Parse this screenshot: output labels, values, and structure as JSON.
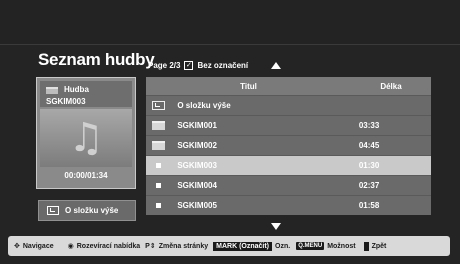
{
  "title": "Seznam hudby",
  "page_info": "Page 2/3",
  "mark_label": "Bez označení",
  "preview": {
    "folder": "Hudba",
    "file": "SGKIM003",
    "time": "00:00/01:34"
  },
  "up_button": "O složku výše",
  "table": {
    "col_title": "Titul",
    "col_length": "Délka",
    "rows": [
      {
        "type": "up",
        "name": "O složku výše",
        "length": ""
      },
      {
        "type": "folder",
        "name": "SGKIM001",
        "length": "03:33"
      },
      {
        "type": "folder",
        "name": "SGKIM002",
        "length": "04:45"
      },
      {
        "type": "file",
        "name": "SGKIM003",
        "length": "01:30"
      },
      {
        "type": "file",
        "name": "SGKIM004",
        "length": "02:37"
      },
      {
        "type": "file",
        "name": "SGKIM005",
        "length": "01:58"
      }
    ]
  },
  "footer": {
    "nav": "Navigace",
    "popup": "Rozevírací nabídka",
    "page": "Změna stránky",
    "mark_key": "MARK (Označit)",
    "mark": "Ozn.",
    "menu_key": "Q.MENU",
    "options": "Možnost",
    "back": "Zpět"
  }
}
